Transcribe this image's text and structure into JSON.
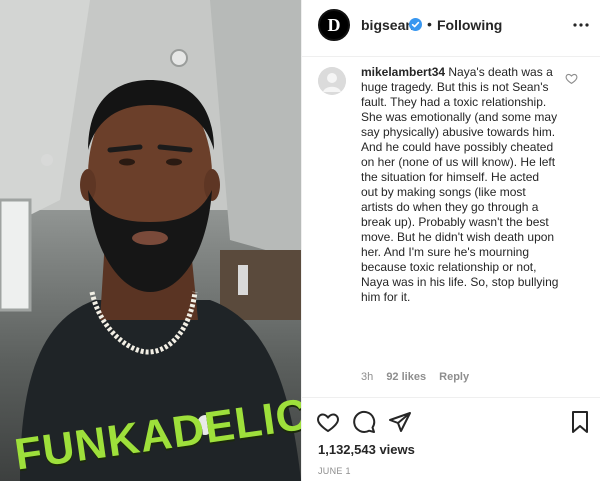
{
  "post": {
    "username": "bigsean",
    "avatar_letter": "D",
    "separator": "•",
    "follow_status": "Following",
    "shirt_print": "FUNKADELIC"
  },
  "comment": {
    "username": "mikelambert34",
    "text": "Naya's death was a huge tragedy. But this is not Sean's fault. They had a toxic relationship. She was emotionally (and some may say physically) abusive towards him. And he could have possibly cheated on her (none of us will know). He left the situation for himself. He acted out by making songs (like most artists do when they go through a break up). Probably wasn't the best move. But he didn't wish death upon her. And I'm sure he's mourning because toxic relationship or not, Naya was in his life. So, stop bullying him for it.",
    "age": "3h",
    "likes": "92 likes",
    "reply_label": "Reply"
  },
  "stats": {
    "views": "1,132,543 views",
    "date": "JUNE 1"
  },
  "colors": {
    "verified": "#3897f0",
    "text": "#262626",
    "muted": "#8e8e8e",
    "shirt_print": "#9ee03b"
  },
  "icons": [
    "verified-badge-icon",
    "more-options-icon",
    "heart-icon",
    "comment-icon",
    "share-icon",
    "bookmark-icon"
  ]
}
